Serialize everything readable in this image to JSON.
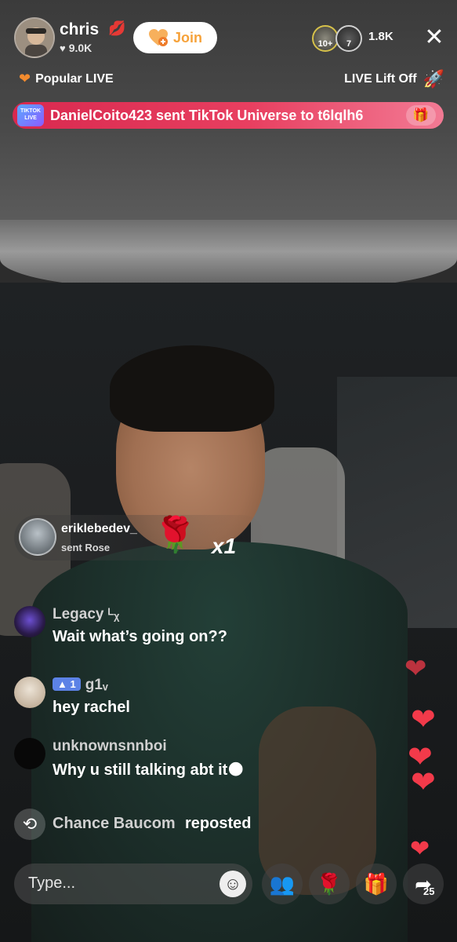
{
  "host": {
    "name": "chris",
    "likes": "9.0K",
    "join_label": "Join"
  },
  "viewers": {
    "avatar_badges": [
      "10+",
      "7"
    ],
    "count": "1.8K"
  },
  "tags": {
    "popular_live": "Popular LIVE",
    "lift_off": "LIVE Lift Off"
  },
  "gift_banner": {
    "badge_text": "TIKTOK LIVE",
    "text": "DanielCoito423 sent TikTok Universe to t6lqlh6"
  },
  "gift_notification": {
    "user": "eriklebedev_",
    "action": "sent Rose",
    "combo": "x1"
  },
  "comments": [
    {
      "user": "Legacy ᴸᵪ",
      "text": "Wait what’s going on??"
    },
    {
      "level": "▲ 1",
      "user": "g1ᵥ",
      "text": "hey rachel"
    },
    {
      "user": "unknownsnnboi",
      "text": "Why u still talking abt it🌑"
    }
  ],
  "repost": {
    "user": "Chance Baucom",
    "action": "reposted"
  },
  "bottom_bar": {
    "input_placeholder": "Type...",
    "share_count": "25"
  },
  "icons": {
    "close": "close-icon",
    "gift": "gift-icon",
    "rose": "rose-icon",
    "share": "share-icon",
    "emoji": "emoji-icon",
    "repost": "repost-icon"
  },
  "colors": {
    "banner_start": "#d9294f",
    "join_text": "#f6a23a",
    "heart": "#f23a4a",
    "level_badge": "#5c82e6"
  }
}
